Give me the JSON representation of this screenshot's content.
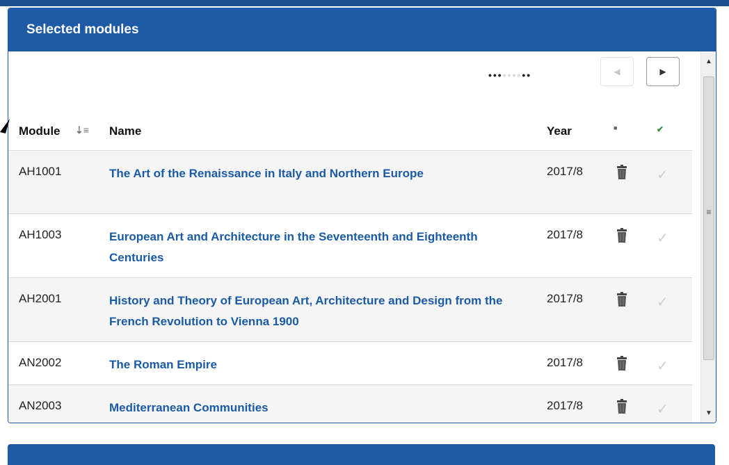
{
  "panel": {
    "title": "Selected modules"
  },
  "pager": {
    "prev_icon": "caret-left-icon",
    "next_icon": "caret-right-icon"
  },
  "columns": {
    "module": "Module",
    "name": "Name",
    "year": "Year"
  },
  "rows": [
    {
      "code": "AH1001",
      "name": "The Art of the Renaissance in Italy and Northern Europe",
      "year": "2017/8"
    },
    {
      "code": "AH1003",
      "name": "European Art and Architecture in the Seventeenth and Eighteenth Centuries",
      "year": "2017/8"
    },
    {
      "code": "AH2001",
      "name": "History and Theory of European Art, Architecture and Design from the French Revolution to Vienna 1900",
      "year": "2017/8"
    },
    {
      "code": "AN2002",
      "name": "The Roman Empire",
      "year": "2017/8"
    },
    {
      "code": "AN2003",
      "name": "Mediterranean Communities",
      "year": "2017/8"
    }
  ],
  "colors": {
    "header_blue": "#1e5aa6",
    "link_blue": "#1b5ba6",
    "check_green": "#2e8b2e"
  }
}
